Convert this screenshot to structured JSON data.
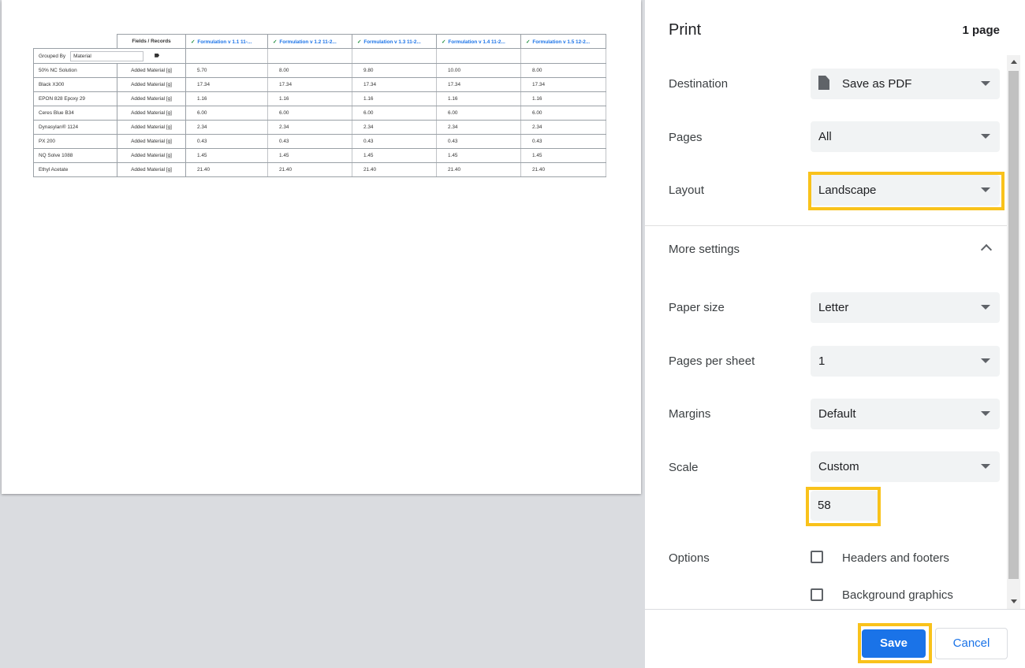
{
  "preview": {
    "fields_header": "Fields / Records",
    "columns": [
      "Formulation v 1.1 11-...",
      "Formulation v 1.2 11-2...",
      "Formulation v 1.3 11-2...",
      "Formulation v 1.4 11-2...",
      "Formulation v 1.5 12-2..."
    ],
    "grouped_by_label": "Grouped By",
    "grouped_by_value": "Material",
    "sub_label": "Added Material [g]",
    "rows": [
      {
        "name": "50% NC Solution",
        "values": [
          "5.70",
          "8.00",
          "9.80",
          "10.00",
          "8.00"
        ]
      },
      {
        "name": "Black X300",
        "values": [
          "17.34",
          "17.34",
          "17.34",
          "17.34",
          "17.34"
        ]
      },
      {
        "name": "EPON 828 Epoxy 29",
        "values": [
          "1.16",
          "1.16",
          "1.16",
          "1.16",
          "1.16"
        ]
      },
      {
        "name": "Ceres Blue B34",
        "values": [
          "6.00",
          "6.00",
          "6.00",
          "6.00",
          "6.00"
        ]
      },
      {
        "name": "Dynasylan® 1124",
        "values": [
          "2.34",
          "2.34",
          "2.34",
          "2.34",
          "2.34"
        ]
      },
      {
        "name": "PX 200",
        "values": [
          "0.43",
          "0.43",
          "0.43",
          "0.43",
          "0.43"
        ]
      },
      {
        "name": "NQ Solve 1088",
        "values": [
          "1.45",
          "1.45",
          "1.45",
          "1.45",
          "1.45"
        ]
      },
      {
        "name": "Ethyl Acetate",
        "values": [
          "21.40",
          "21.40",
          "21.40",
          "21.40",
          "21.40"
        ]
      }
    ]
  },
  "print": {
    "title": "Print",
    "page_count": "1 page",
    "destination": {
      "label": "Destination",
      "value": "Save as PDF"
    },
    "pages": {
      "label": "Pages",
      "value": "All"
    },
    "layout": {
      "label": "Layout",
      "value": "Landscape"
    },
    "more_settings": "More settings",
    "paper_size": {
      "label": "Paper size",
      "value": "Letter"
    },
    "pages_per_sheet": {
      "label": "Pages per sheet",
      "value": "1"
    },
    "margins": {
      "label": "Margins",
      "value": "Default"
    },
    "scale": {
      "label": "Scale",
      "value": "Custom",
      "custom_value": "58"
    },
    "options": {
      "label": "Options",
      "headers_footers": "Headers and footers",
      "background_graphics": "Background graphics"
    },
    "save_label": "Save",
    "cancel_label": "Cancel",
    "highlight_color": "#f9c21b",
    "accent_color": "#1a73e8"
  }
}
